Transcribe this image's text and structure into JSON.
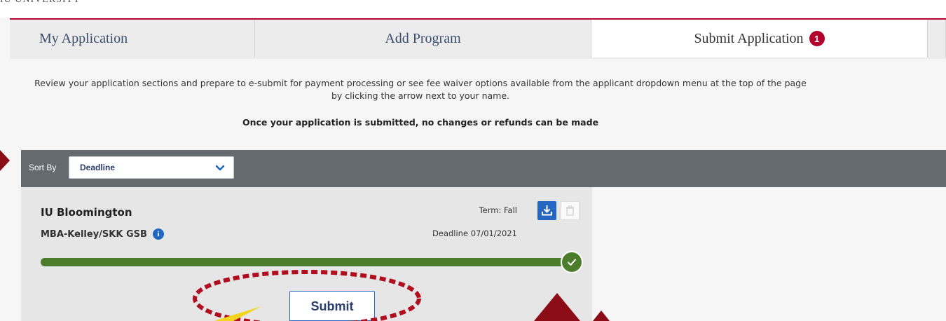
{
  "header": {
    "cut_text": "IU UNIVERSITY"
  },
  "tabs": [
    {
      "label": "My Application"
    },
    {
      "label": "Add Program"
    },
    {
      "label": "Submit Application",
      "badge": "1"
    }
  ],
  "intro": {
    "text": "Review your application sections and prepare to e-submit for payment processing or see fee waiver options available from the applicant dropdown menu at the top of the page by clicking the arrow next to your name.",
    "warning": "Once your application is submitted, no changes or refunds can be made"
  },
  "sort": {
    "label": "Sort By",
    "value": "Deadline"
  },
  "card": {
    "school": "IU Bloomington",
    "program": "MBA-Kelley/SKK GSB",
    "term": "Term: Fall",
    "deadline": "Deadline 07/01/2021",
    "progress": 1.0,
    "submit_label": "Submit"
  },
  "colors": {
    "accent": "#b4002d",
    "primary_blue": "#2466c2",
    "progress_green": "#4c7d2c",
    "sortbar_gray": "#636b70",
    "annotation_red": "#b00d1e",
    "annotation_arrow": "#8b0c16",
    "annotation_yellow": "#f3d51d"
  },
  "icons": {
    "info": "info-icon",
    "download": "download-icon",
    "trash": "trash-icon",
    "check": "check-icon",
    "chevron": "chevron-down-icon"
  }
}
